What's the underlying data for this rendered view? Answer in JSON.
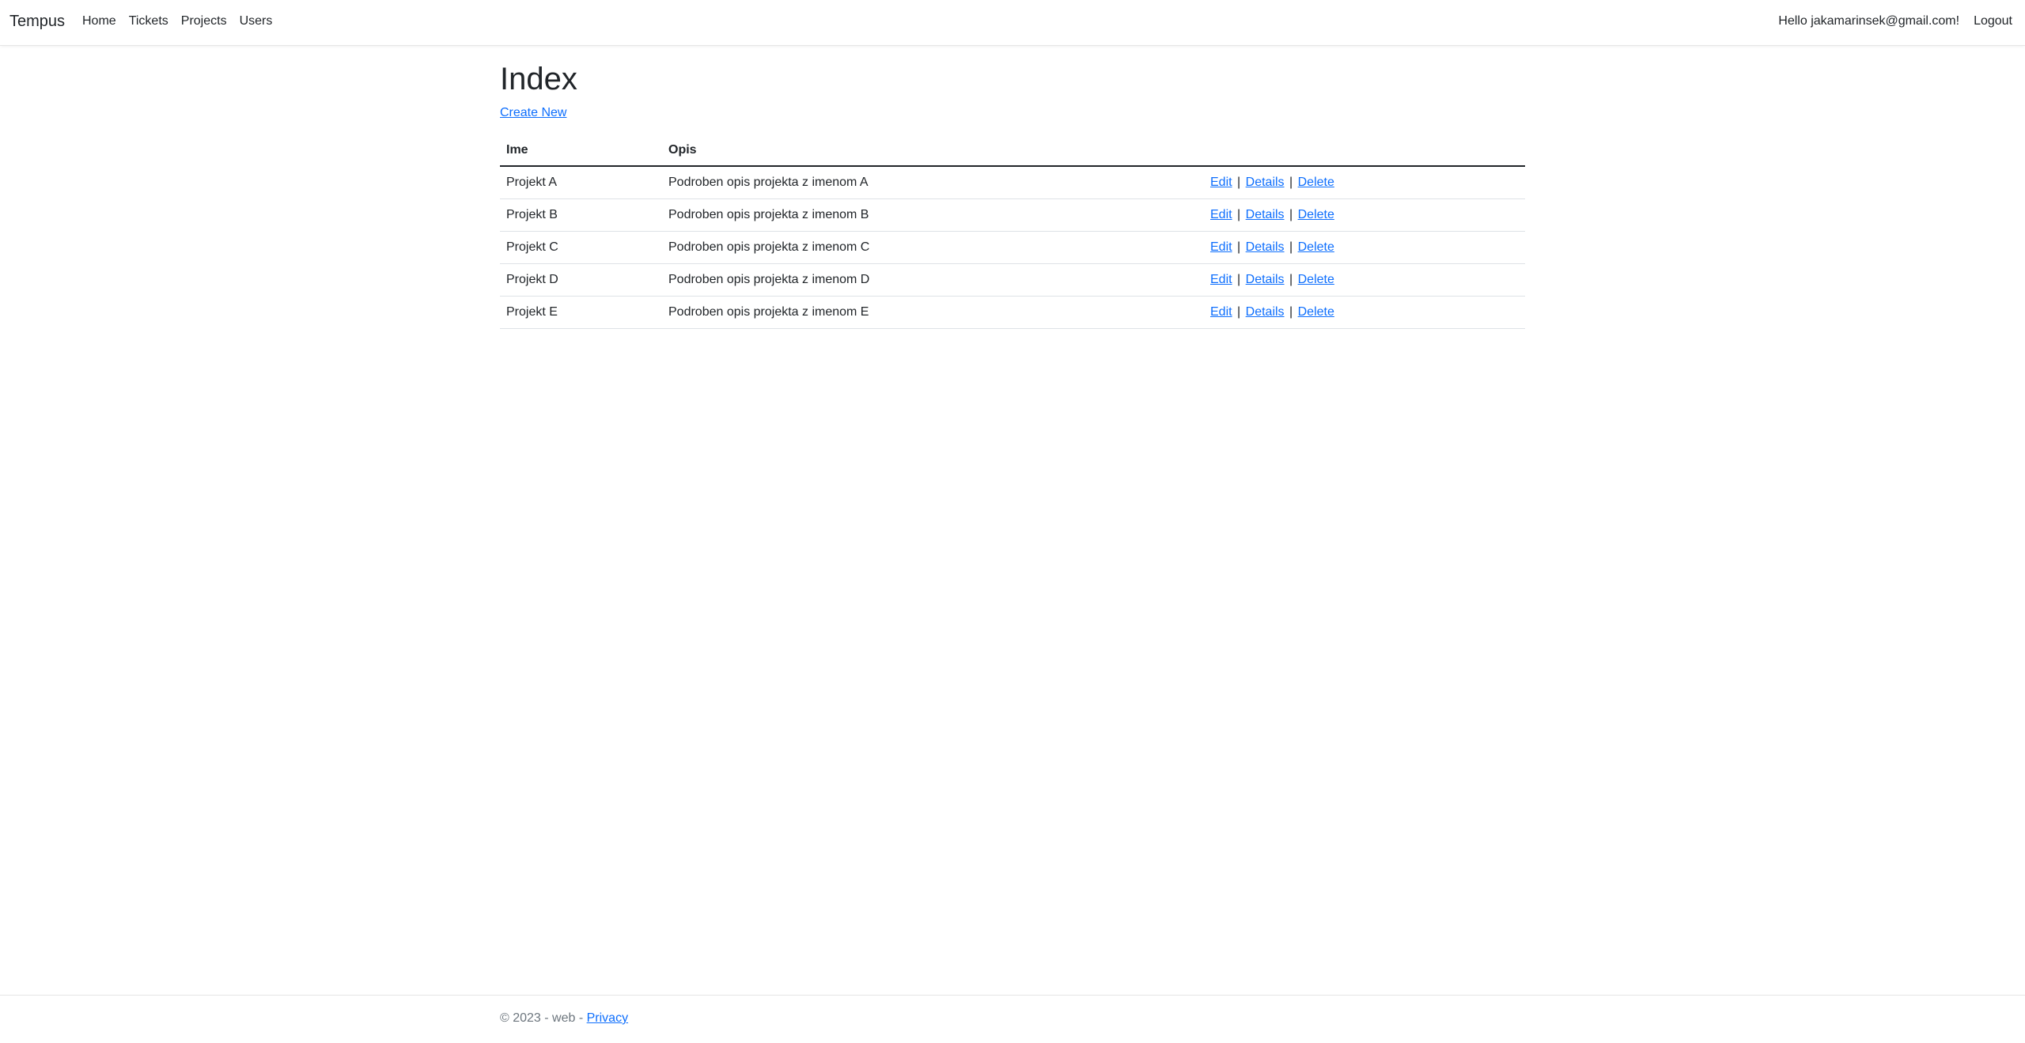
{
  "navbar": {
    "brand": "Tempus",
    "links": [
      "Home",
      "Tickets",
      "Projects",
      "Users"
    ],
    "greeting": "Hello jakamarinsek@gmail.com!",
    "logout": "Logout"
  },
  "main": {
    "title": "Index",
    "create_new": "Create New",
    "table": {
      "headers": [
        "Ime",
        "Opis",
        ""
      ],
      "rows": [
        {
          "name": "Projekt A",
          "description": "Podroben opis projekta z imenom A"
        },
        {
          "name": "Projekt B",
          "description": "Podroben opis projekta z imenom B"
        },
        {
          "name": "Projekt C",
          "description": "Podroben opis projekta z imenom C"
        },
        {
          "name": "Projekt D",
          "description": "Podroben opis projekta z imenom D"
        },
        {
          "name": "Projekt E",
          "description": "Podroben opis projekta z imenom E"
        }
      ],
      "actions": {
        "edit": "Edit",
        "details": "Details",
        "delete": "Delete",
        "separator": "|"
      }
    }
  },
  "footer": {
    "text": "© 2023 - web -",
    "privacy": "Privacy"
  },
  "colors": {
    "link": "#0d6efd",
    "text": "#212529",
    "muted": "#6c757d"
  }
}
